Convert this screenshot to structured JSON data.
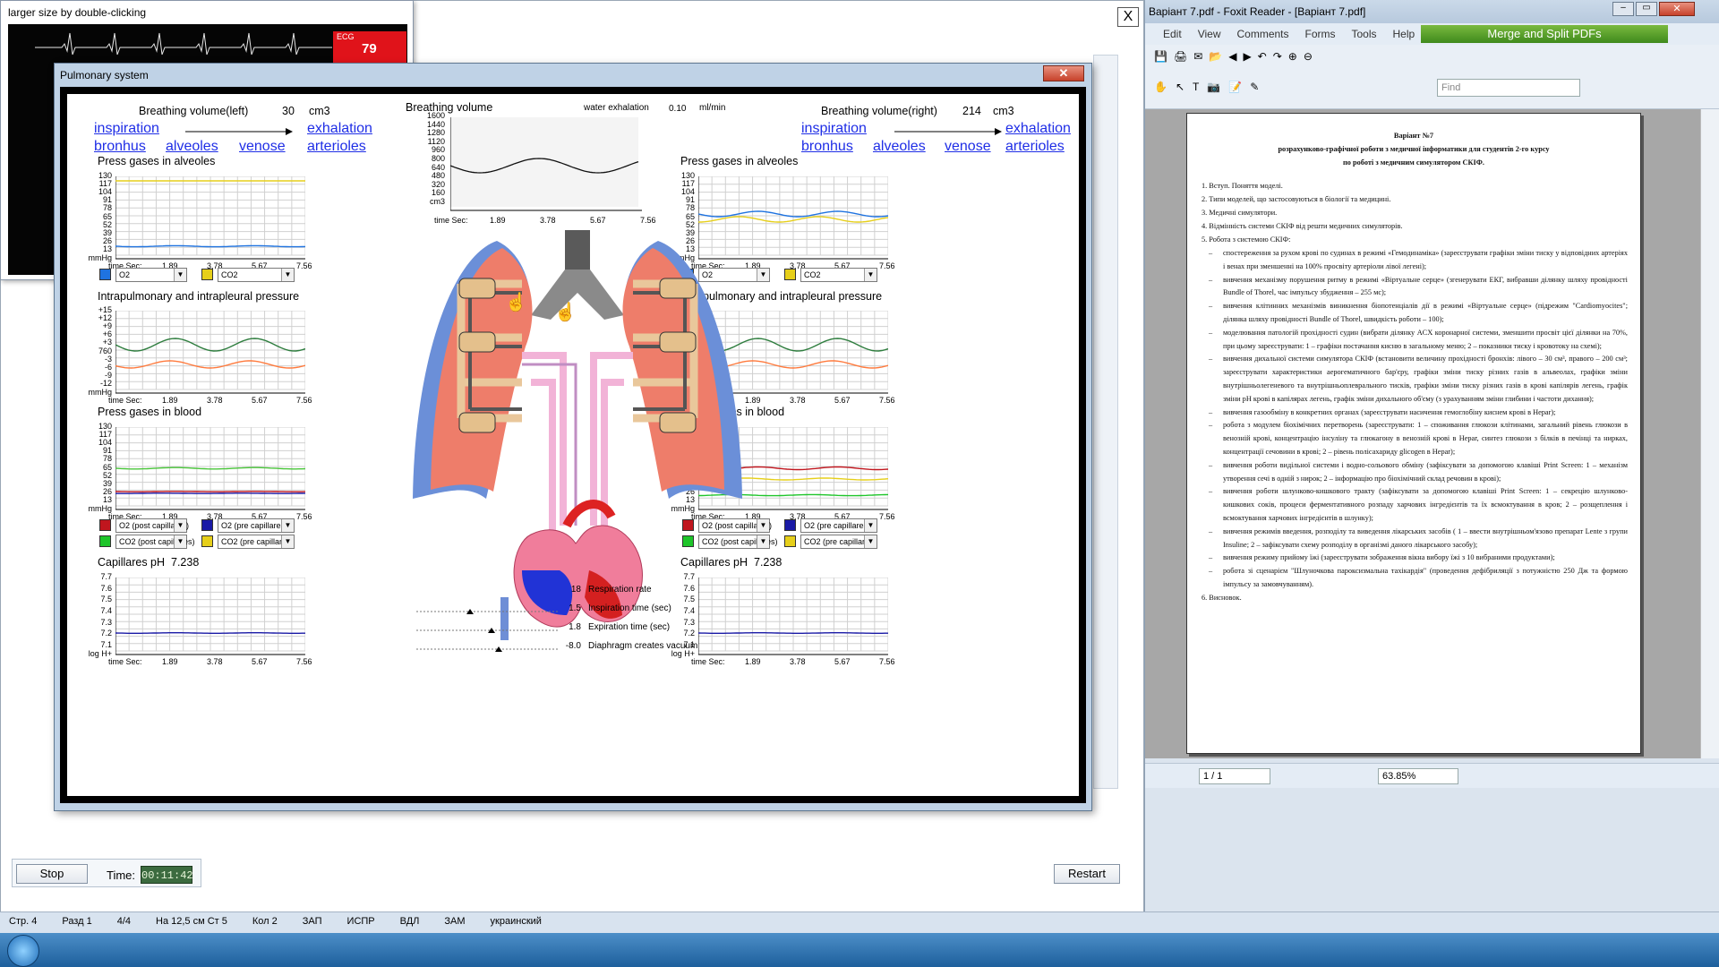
{
  "app": {
    "restart_label": "Restart",
    "stop_label": "Stop",
    "time_label": "Time:",
    "time_value": "00:11:42",
    "close_label": "X"
  },
  "ecg": {
    "title": "larger size by double-clicking",
    "label": "ECG",
    "value": "79"
  },
  "pulmonary": {
    "title": "Pulmonary system",
    "left": {
      "breathing_label": "Breathing volume(left)",
      "breathing_value": "30",
      "unit": "cm3",
      "link_inspiration": "inspiration",
      "link_exhalation": "exhalation",
      "link_bronhus": "bronhus",
      "link_alveoles": "alveoles",
      "link_venose": "venose",
      "link_arterioles": "arterioles",
      "ph_value": "7.238"
    },
    "right": {
      "breathing_label": "Breathing volume(right)",
      "breathing_value": "214",
      "unit": "cm3",
      "link_inspiration": "inspiration",
      "link_exhalation": "exhalation",
      "link_bronhus": "bronhus",
      "link_alveoles": "alveoles",
      "link_venose": "venose",
      "link_arterioles": "arterioles",
      "ph_value": "7.238"
    },
    "center": {
      "title": "Breathing volume",
      "water_label": "water exhalation",
      "water_value": "0.10",
      "water_unit": "ml/min",
      "yticks": [
        "1600",
        "1440",
        "1280",
        "1120",
        "960",
        "800",
        "640",
        "480",
        "320",
        "160",
        "cm3"
      ]
    },
    "chart_titles": {
      "alveoles": "Press gases in alveoles",
      "pressure": "Intrapulmonary and intrapleural pressure",
      "blood": "Press gases in blood",
      "ph": "Capillares pH"
    },
    "time_axis": {
      "label": "time Sec:",
      "ticks": [
        "1.89",
        "3.78",
        "5.67",
        "7.56"
      ]
    },
    "gas_ticks": [
      "130",
      "117",
      "104",
      "91",
      "78",
      "65",
      "52",
      "39",
      "26",
      "13",
      "mmHg"
    ],
    "pressure_ticks": [
      "+15",
      "+12",
      "+9",
      "+6",
      "+3",
      "760",
      "-3",
      "-6",
      "-9",
      "-12",
      "mmHg"
    ],
    "ph_ticks": [
      "7.7",
      "7.6",
      "7.5",
      "7.4",
      "7.3",
      "7.2",
      "7.1",
      "log H+"
    ],
    "alveoles_selects": [
      {
        "label": "O2",
        "color": "#1f73e0"
      },
      {
        "label": "CO2",
        "color": "#e6cf1a"
      }
    ],
    "blood_selects": [
      {
        "label": "O2  (post capillares)",
        "color": "#c0161e"
      },
      {
        "label": "O2  (pre capillares)",
        "color": "#1a1aa6"
      },
      {
        "label": "CO2  (post capillares)",
        "color": "#1ec52a"
      },
      {
        "label": "CO2  (pre capillares)",
        "color": "#e6cf1a"
      }
    ],
    "params": [
      {
        "value": "18",
        "label": "Respiration rate"
      },
      {
        "value": "1.5",
        "label": "Inspiration time (sec)"
      },
      {
        "value": "1.8",
        "label": "Expiration time (sec)"
      },
      {
        "value": "-8.0",
        "label": "Diaphragm creates vacuum"
      }
    ]
  },
  "foxit": {
    "title": "Варіант 7.pdf - Foxit Reader - [Варіант 7.pdf]",
    "menu": [
      "Edit",
      "View",
      "Comments",
      "Forms",
      "Tools",
      "Help"
    ],
    "banner": "Merge and Split PDFs",
    "find_placeholder": "Find",
    "page_nav": "1 / 1",
    "zoom": "63.85%",
    "doc": {
      "h1": "Варіант №7",
      "h2": "розрахунково-графічної роботи з медичної інформатики для студентів 2-го курсу",
      "h3": "по роботі з медичним симулятором СКІФ.",
      "items": [
        "1. Вступ. Поняття моделі.",
        "2. Типи моделей, що застосовуються в біології та медицині.",
        "3. Медичні симулятори.",
        "4. Відмінність системи СКІФ від решти медичних симуляторів.",
        "5. Робота з системою СКІФ:"
      ],
      "bullets": [
        "спостереження за рухом крові по судинах в режимі «Гемодинаміка» (зареєструвати графіки зміни тиску у відповідних артеріях і венах при зменшенні на 100% просвіту артеріоли лівої легені);",
        "вивчення механізму порушення ритму в режимі «Віртуальне серце» (згенерувати ЕКГ, вибравши ділянку шляху провідності Bundle of Thorel, час імпульсу збудження – 255 мс);",
        "вивчення клітинних механізмів виникнення біопотенціалів дії в режимі «Віртуальне серце» (підрежим \"Cardiomyocites\"; ділянка шляху провідності Bundle of Thorel, швидкість роботи – 100);",
        "моделювання патологій прохідності судин (вибрати ділянку ACX коронарної системи, зменшити просвіт цієї ділянки на 70%, при цьому зареєструвати: 1 – графіки постачання кисню в загальному меню; 2 – показники тиску і кровотоку на схемі);",
        "вивчення дихальної системи симулятора СКІФ (встановити величину прохідності бронхів: лівого – 30 см³, правого – 200 см³; зареєструвати характеристики аерогематичного бар'єру, графіки зміни тиску різних газів в альвеолах, графіки зміни внутрішньолегеневого та внутрішньоплеврального тисків, графіки зміни тиску різних газів в крові капілярів легень, графік зміни pH крові в капілярах легень, графік зміни дихального об'єму (з урахуванням зміни глибини і частоти дихання);",
        "вивчення газообміну в конкретних органах (зареєструвати насичення гемоглобіну киснем крові в Hepar);",
        "робота з модулем біохімічних перетворень (зареєструвати: 1 – споживання глюкози клітинами, загальний рівень глюкози в венозній крові, концентрацію інсуліну та глюкагону в венозній крові в Hepar, синтез глюкози з білків в печінці та нирках, концентрації сечовини в крові; 2 – рівень полісахариду glicogen в Hepar);",
        "вивчення роботи видільної системи і водно-сольового обміну (зафіксувати за допомогою клавіші Print Screen: 1 – механізм утворення сечі в одній з нирок; 2 – інформацію про біохімічний склад речовин в крові);",
        "вивчення роботи шлунково-кишкового тракту (зафіксувати за допомогою клавіші Print Screen: 1 – секрецію шлунково-кишкових соків, процеси ферментативного розпаду харчових інгредієнтів та їх всмоктування в кров; 2 – розщеплення і всмоктування харчових інгредієнтів в шлунку);",
        "вивчення режимів введення, розподілу та виведення лікарських засобів ( 1 – ввести внутрішньом'язово препарат Lente з групи Insuline; 2 – зафіксувати схему розподілу в організмі даного лікарського засобу);",
        "вивчення режиму прийому їжі (зареєструвати зображення вікна вибору їжі з 10 вибраними продуктами);",
        "робота зі сценарієм \"Шлуночкова пароксизмальна тахікардія\" (проведення дефібриляції з потужністю 250 Дж та формою імпульсу за замовчуванням)."
      ],
      "end": "6. Висновок."
    }
  },
  "word_status": [
    "Стр. 4",
    "Разд 1",
    "4/4",
    "На 12,5 см  Ст 5",
    "Кол 2",
    "ЗАП",
    "ИСПР",
    "ВДЛ",
    "ЗАМ",
    "украинский"
  ]
}
